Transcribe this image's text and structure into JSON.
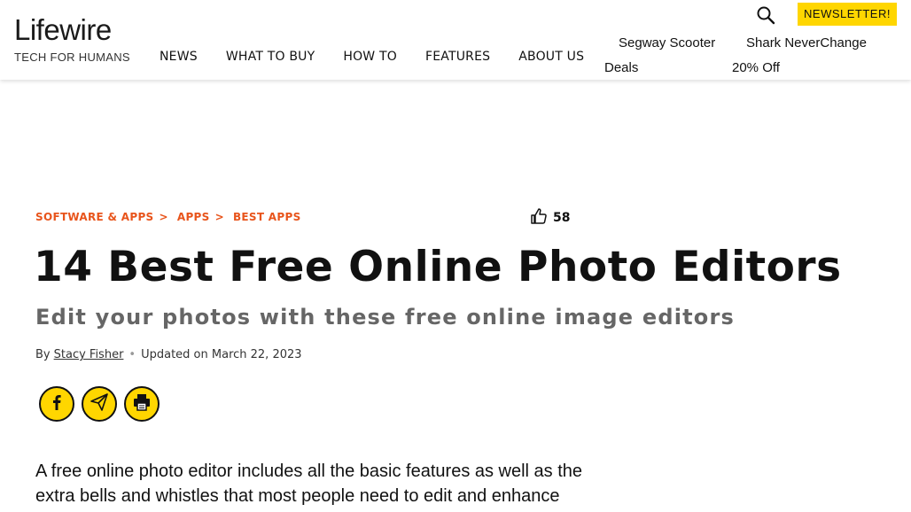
{
  "header": {
    "logo": "Lifewire",
    "tagline": "TECH FOR HUMANS",
    "nav": [
      "NEWS",
      "WHAT TO BUY",
      "HOW TO",
      "FEATURES",
      "ABOUT US"
    ],
    "promos": [
      {
        "line1": "Segway Scooter",
        "line2": "Deals"
      },
      {
        "line1": "Shark NeverChange",
        "line2": "20% Off"
      }
    ],
    "newsletter_label": "NEWSLETTER!"
  },
  "article": {
    "breadcrumb": [
      "SOFTWARE & APPS",
      "APPS",
      "BEST APPS"
    ],
    "breadcrumb_sep": ">",
    "likes": "58",
    "title": "14 Best Free Online Photo Editors",
    "subtitle": "Edit your photos with these free online image editors",
    "byline_prefix": "By",
    "author": "Stacy Fisher",
    "updated": "Updated on March 22, 2023",
    "body_line1": "A free online photo editor includes all the basic features as well as the",
    "body_line2": "extra bells and whistles that most people need to edit and enhance"
  },
  "colors": {
    "accent": "#e8541b",
    "newsletter_bg": "#ffd600",
    "share_bg": "#ffd600"
  }
}
